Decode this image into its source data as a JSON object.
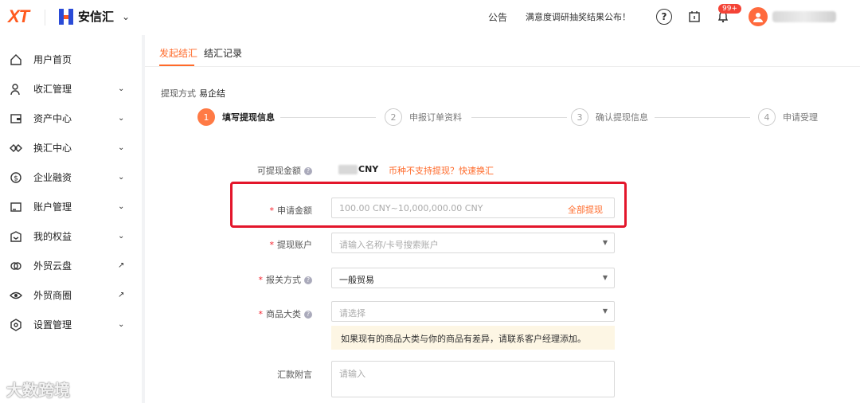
{
  "topbar": {
    "logo": "XT",
    "brand": "安信汇",
    "notice_label": "公告",
    "notice_text": "满意度调研抽奖结果公布！",
    "badge": "99+",
    "icons": [
      "help-icon",
      "calendar-icon",
      "bell-icon",
      "user-avatar-icon"
    ]
  },
  "sidebar": {
    "items": [
      {
        "label": "用户首页",
        "icon": "home-icon",
        "arrow": ""
      },
      {
        "label": "收汇管理",
        "icon": "user-icon",
        "arrow": "⌄"
      },
      {
        "label": "资产中心",
        "icon": "wallet-icon",
        "arrow": "⌄"
      },
      {
        "label": "换汇中心",
        "icon": "exchange-icon",
        "arrow": "⌄"
      },
      {
        "label": "企业融资",
        "icon": "money-icon",
        "arrow": "⌄"
      },
      {
        "label": "账户管理",
        "icon": "account-icon",
        "arrow": "⌄"
      },
      {
        "label": "我的权益",
        "icon": "gift-icon",
        "arrow": "⌄"
      },
      {
        "label": "外贸云盘",
        "icon": "cloud-icon",
        "arrow": "↗"
      },
      {
        "label": "外贸商圈",
        "icon": "eye-icon",
        "arrow": "↗"
      },
      {
        "label": "设置管理",
        "icon": "settings-icon",
        "arrow": "⌄"
      }
    ],
    "watermark": "大数跨境"
  },
  "tabs": [
    {
      "label": "发起结汇",
      "active": true
    },
    {
      "label": "结汇记录",
      "active": false
    }
  ],
  "withdraw_method": {
    "label": "提现方式",
    "value": "易企结"
  },
  "steps": [
    {
      "num": "1",
      "label": "填写提现信息",
      "active": true
    },
    {
      "num": "2",
      "label": "申报订单资料",
      "active": false
    },
    {
      "num": "3",
      "label": "确认提现信息",
      "active": false
    },
    {
      "num": "4",
      "label": "申请受理",
      "active": false
    }
  ],
  "form": {
    "available": {
      "label": "可提现金额",
      "currency": "CNY",
      "tip": "币种不支持提现？快速换汇"
    },
    "amount": {
      "label": "申请金额",
      "placeholder": "100.00 CNY~10,000,000.00 CNY",
      "all_button": "全部提现"
    },
    "account": {
      "label": "提现账户",
      "placeholder": "请输入名称/卡号搜索账户"
    },
    "customs": {
      "label": "报关方式",
      "value": "一般贸易"
    },
    "category": {
      "label": "商品大类",
      "placeholder": "请选择",
      "notice": "如果现有的商品大类与你的商品有差异，请联系客户经理添加。"
    },
    "remark": {
      "label": "汇款附言",
      "placeholder": "请输入"
    }
  },
  "colors": {
    "accent": "#ff6a2a",
    "highlight": "#e3162b",
    "brand_blue": "#2a4bd7"
  }
}
